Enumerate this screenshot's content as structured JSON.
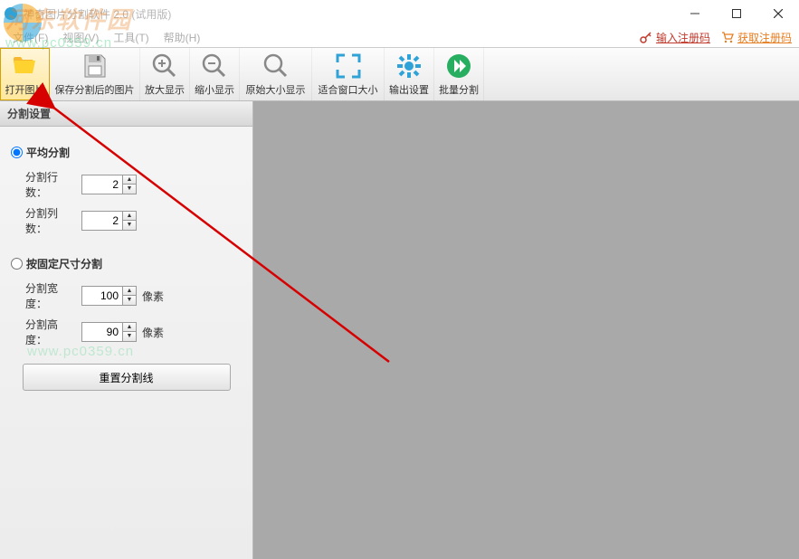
{
  "window": {
    "title": "神奇图片分割软件 2.0 (试用版)"
  },
  "menu": {
    "file": "文件(F)",
    "view": "视图(V)",
    "tool": "工具(T)",
    "help": "帮助(H)"
  },
  "reg": {
    "enter": "输入注册码",
    "get": "获取注册码"
  },
  "toolbar": {
    "open": "打开图片",
    "save": "保存分割后的图片",
    "zoomin": "放大显示",
    "zoomout": "缩小显示",
    "orig": "原始大小显示",
    "fit": "适合窗口大小",
    "output": "输出设置",
    "batch": "批量分割"
  },
  "sidebar": {
    "header": "分割设置",
    "avg": {
      "radio": "平均分割",
      "rows_label": "分割行数：",
      "rows_value": "2",
      "cols_label": "分割列数：",
      "cols_value": "2"
    },
    "fixed": {
      "radio": "按固定尺寸分割",
      "w_label": "分割宽度：",
      "w_value": "100",
      "h_label": "分割高度：",
      "h_value": "90",
      "unit": "像素"
    },
    "reset": "重置分割线"
  },
  "watermark": {
    "title": "河东软件园",
    "url": "www.pc0359.cn"
  }
}
